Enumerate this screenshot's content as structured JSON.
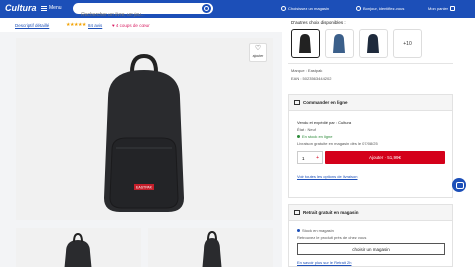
{
  "header": {
    "logo": "Cultura",
    "menu_label": "Menu",
    "search_placeholder": "Rechercher un livre, un jeu...",
    "store_label": "Choisissez un magasin",
    "account_label": "Bonjour, identifiez-vous",
    "cart_label": "Mon panier",
    "brand_color": "#1c4fb8"
  },
  "subbar": {
    "description_link": "Descriptif détaillé",
    "stars": "★★★★★",
    "reviews": "84 avis",
    "favorites": "♥ 4 coups de cœur"
  },
  "gallery": {
    "add_label": "ajouter",
    "heart": "♡",
    "brand_patch": "EASTPAK"
  },
  "options": {
    "title": "D'autres choix disponibles :",
    "more": "+10",
    "brand": "Marque : Eastpak",
    "ean": "EAN : 5023563444202"
  },
  "online": {
    "title": "Commander en ligne",
    "seller": "Vendu et expédié par : Cultura",
    "state": "État : Neuf",
    "stock": "En stock en ligne",
    "delivery": "Livraison gratuite en magasin dès le 07/08/25",
    "qty": "1",
    "plus": "+",
    "cart_button": "Ajouter  ·  51,99€",
    "options_link": "Voir toutes les options de livraison"
  },
  "store": {
    "title": "Retrait gratuit en magasin",
    "stock": "Stock en magasin",
    "reserve": "Retrouvez le produit près de chez vous",
    "choose_button": "choisir un magasin",
    "more_link": "En savoir plus sur le Retrait 2h"
  }
}
